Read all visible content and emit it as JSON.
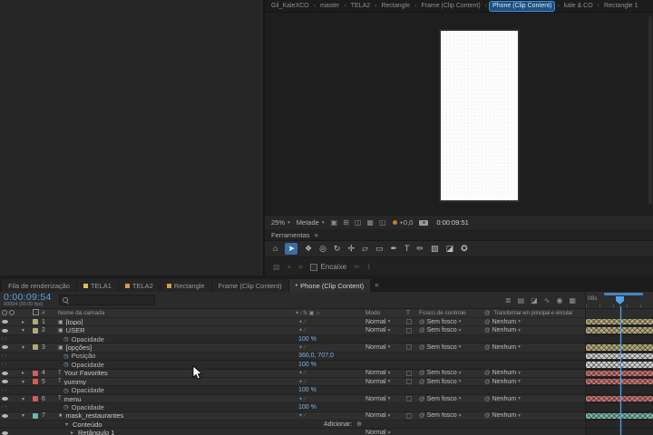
{
  "colors": {
    "accent_blue": "#3f8fd9",
    "timecode_blue": "#5c9fe0",
    "value_blue": "#7db4e6",
    "bar_tan": "#b3a878",
    "bar_red": "#c77171",
    "bar_aqua": "#7cb4a8",
    "bar_light": "#cfcfcf"
  },
  "icons": {
    "panel_menu": "≡",
    "dropdown": "▾",
    "twirl_open": "▾",
    "twirl_closed": "▸",
    "stopwatch": "◷",
    "pick_whip": "@",
    "add_button": "⊕",
    "knav_prev": "‹",
    "knav_next": "›",
    "layer_switches": "✦ ∕",
    "switch_header": "✦ ∕ fx ▣ ☼"
  },
  "comp_navigator": {
    "separator": "‹",
    "items": [
      {
        "label": "Gil_KaleXCO"
      },
      {
        "label": "master"
      },
      {
        "label": "TELA2"
      },
      {
        "label": "Rectangle"
      },
      {
        "label": "Frame (Clip Content)"
      },
      {
        "label": "Phone (Clip Content)",
        "active": true
      },
      {
        "label": "kale & CO"
      },
      {
        "label": "Rectangle 1"
      }
    ]
  },
  "viewer": {
    "zoom_value": "25%",
    "resolution_value": "Metade",
    "exposure_value": "+0,0",
    "timecode": "0:00:09:51",
    "toolbar_icons": [
      {
        "name": "region-of-interest-icon",
        "glyph": "▣"
      },
      {
        "name": "guides-grid-icon",
        "glyph": "⊞"
      },
      {
        "name": "mask-visibility-icon",
        "glyph": "◫"
      },
      {
        "name": "channels-icon",
        "glyph": "▦"
      },
      {
        "name": "transparency-grid-icon",
        "glyph": "◱"
      }
    ]
  },
  "tools_panel": {
    "title": "Ferramentas",
    "snap_label": "Encaixe",
    "tools": [
      {
        "name": "home-tool",
        "glyph": "⌂"
      },
      {
        "name": "selection-tool",
        "glyph": "➤",
        "active": true
      },
      {
        "name": "hand-tool",
        "glyph": "❖"
      },
      {
        "name": "zoom-tool",
        "glyph": "◎"
      },
      {
        "name": "orbit-camera-tool",
        "glyph": "↻"
      },
      {
        "name": "pan-camera-tool",
        "glyph": "✢"
      },
      {
        "name": "pan-behind-tool",
        "glyph": "▱"
      },
      {
        "name": "shape-tool",
        "glyph": "▭"
      },
      {
        "name": "pen-tool",
        "glyph": "✒"
      },
      {
        "name": "type-tool",
        "glyph": "T"
      },
      {
        "name": "brush-tool",
        "glyph": "✏"
      },
      {
        "name": "clone-stamp-tool",
        "glyph": "▨"
      },
      {
        "name": "eraser-tool",
        "glyph": "◪"
      },
      {
        "name": "puppet-tool",
        "glyph": "✪"
      }
    ],
    "secondary_left": [
      {
        "name": "roto-brush-tool",
        "glyph": "▧"
      },
      {
        "name": "puppet-pin-tool",
        "glyph": "⌖"
      },
      {
        "name": "camera-track-tool",
        "glyph": "⌗"
      }
    ],
    "secondary_right": [
      {
        "name": "scissors-icon",
        "glyph": "✂"
      },
      {
        "name": "wave-icon",
        "glyph": "⌇"
      }
    ]
  },
  "timeline": {
    "tabs": [
      {
        "label": "Fila de renderização"
      },
      {
        "label": "TELA1",
        "chip": "#d6c353"
      },
      {
        "label": "TELA2",
        "chip": "#cf9a52"
      },
      {
        "label": "Rectangle",
        "chip": "#cf9a52"
      },
      {
        "label": "Frame (Clip Content)"
      },
      {
        "label": "Phone (Clip Content)",
        "active": true,
        "bullet": "•"
      }
    ],
    "timecode": "0:00:09:54",
    "frame_info": "00094 (30.00 fps)",
    "ruler_label": "08s",
    "add_label": "Adicionar:",
    "columns": {
      "num": "#",
      "name": "Nome da camada",
      "mode": "Modo",
      "t": "T",
      "matte": "Fosco de controle",
      "parent": "Transformar em principal e vincular"
    },
    "head_icons": [
      {
        "name": "comp-mini-flowchart-icon",
        "glyph": "≣"
      },
      {
        "name": "draft-3d-icon",
        "glyph": "▤"
      },
      {
        "name": "hide-shy-layers-icon",
        "glyph": "◪"
      },
      {
        "name": "frame-blending-icon",
        "glyph": "∿"
      },
      {
        "name": "motion-blur-icon",
        "glyph": "◉"
      },
      {
        "name": "graph-editor-icon",
        "glyph": "▦"
      }
    ],
    "rows": [
      {
        "kind": "layer",
        "num": "1",
        "name": "[topo]",
        "icon": "▣",
        "chip": "#b3a878",
        "twirl": "closed",
        "mode": "Normal",
        "matte": "Sem fosco",
        "parent": "Nenhum",
        "bar": "#b3a878"
      },
      {
        "kind": "layer",
        "num": "2",
        "name": "USER",
        "icon": "▣",
        "chip": "#b3a878",
        "twirl": "open",
        "mode": "Normal",
        "matte": "Sem fosco",
        "parent": "Nenhum",
        "bar": "#b3a878"
      },
      {
        "kind": "prop",
        "name": "Opacidade",
        "value": "100 %"
      },
      {
        "kind": "layer",
        "num": "3",
        "name": "[opções]",
        "icon": "▣",
        "chip": "#b3a878",
        "twirl": "open",
        "mode": "Normal",
        "matte": "Sem fosco",
        "parent": "Nenhum",
        "bar": "#b3a878"
      },
      {
        "kind": "prop",
        "name": "Posição",
        "value": "360,0, 707,0",
        "bar": "#cfcfcf"
      },
      {
        "kind": "prop",
        "name": "Opacidade",
        "value": "100 %",
        "bar": "#cfcfcf"
      },
      {
        "kind": "layer",
        "num": "4",
        "name": "Your Favorites",
        "icon": "T",
        "chip": "#cf5f5f",
        "twirl": "closed",
        "mode": "Normal",
        "matte": "Sem fosco",
        "parent": "Nenhum",
        "bar": "#c77171"
      },
      {
        "kind": "layer",
        "num": "5",
        "name": "yummy",
        "icon": "T",
        "chip": "#cf5f5f",
        "twirl": "open",
        "mode": "Normal",
        "matte": "Sem fosco",
        "parent": "Nenhum",
        "bar": "#c77171"
      },
      {
        "kind": "prop",
        "name": "Opacidade",
        "value": "100 %"
      },
      {
        "kind": "layer",
        "num": "6",
        "name": "menu",
        "icon": "T",
        "chip": "#cf5f5f",
        "twirl": "open",
        "mode": "Normal",
        "matte": "Sem fosco",
        "parent": "Nenhum",
        "bar": "#c77171"
      },
      {
        "kind": "prop",
        "name": "Opacidade",
        "value": "100 %"
      },
      {
        "kind": "layer",
        "num": "7",
        "name": "mask_restaurantes",
        "icon": "★",
        "chip": "#6fb3a7",
        "twirl": "open",
        "mode": "Normal",
        "matte": "Sem fosco",
        "parent": "Nenhum",
        "bar": "#7cb4a8"
      },
      {
        "kind": "group",
        "name": "Conteúdo",
        "twirl": "open"
      },
      {
        "kind": "sublayer",
        "name": "Retângulo 1",
        "twirl": "closed",
        "mode": "Normal"
      }
    ]
  }
}
